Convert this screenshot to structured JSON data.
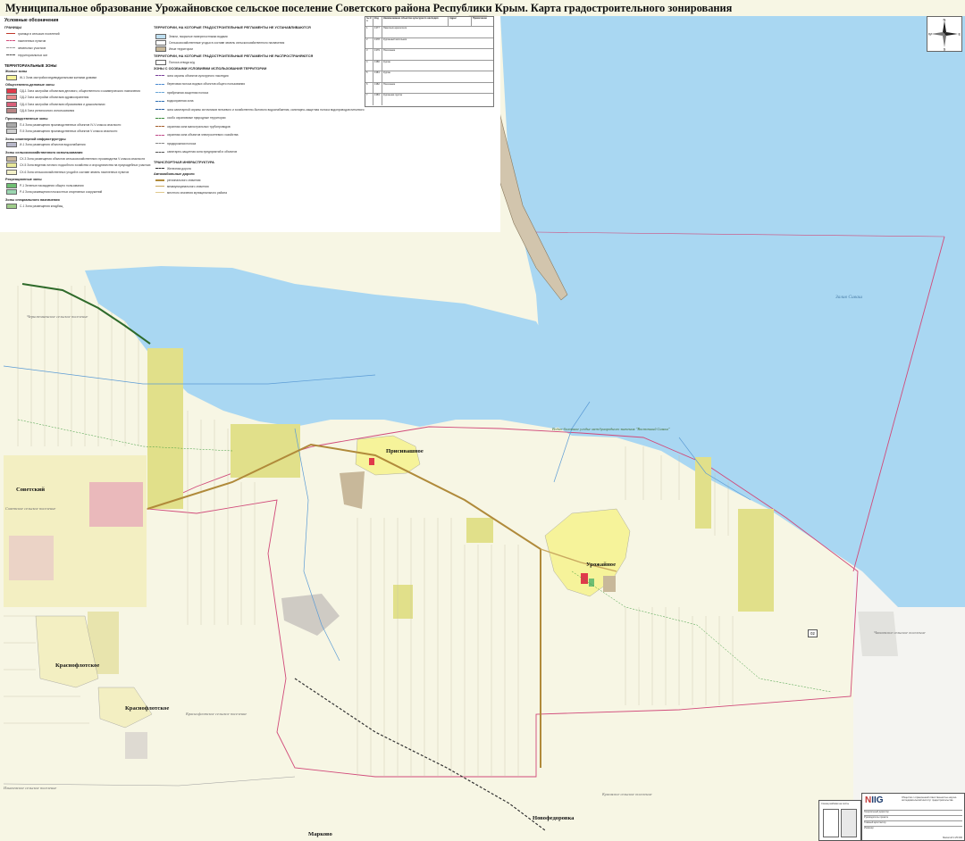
{
  "title": "Муниципальное образование Урожайновское сельское поселение Советского района Республики Крым. Карта градостроительного зонирования",
  "legend": {
    "heading": "Условные обозначения",
    "boundaries_heading": "ГРАНИЦЫ",
    "boundaries": [
      {
        "label": "граница в сельских поселений",
        "color": "#c0392b"
      },
      {
        "label": "населенных пунктов",
        "color": "#d14a7a"
      },
      {
        "label": "земельных участков",
        "color": "#999999"
      },
      {
        "label": "территориальных зон",
        "color": "#555555"
      }
    ],
    "zones_heading": "ТЕРРИТОРИАЛЬНЫЕ ЗОНЫ",
    "groups": [
      {
        "name": "Жилые зоны",
        "items": [
          {
            "code": "Ж-1",
            "label": "Ж-1 Зона застройки индивидуальными жилыми домами",
            "color": "#f6f39a"
          }
        ]
      },
      {
        "name": "Общественно-деловые зоны",
        "items": [
          {
            "code": "ОД-1",
            "label": "ОД-1 Зона застройки объектами делового, общественного и коммерческого назначения",
            "color": "#e03a4a"
          },
          {
            "code": "ОД-2",
            "label": "ОД-2 Зона застройки объектами здравоохранения",
            "color": "#e88a8a"
          },
          {
            "code": "ОД-4",
            "label": "ОД-4 Зона застройки объектами образования и дошкольными",
            "color": "#d9607a"
          },
          {
            "code": "ОД-6",
            "label": "ОД-6 Зона религиозного использования",
            "color": "#b98585"
          }
        ]
      },
      {
        "name": "Производственные зоны",
        "items": [
          {
            "code": "П-4",
            "label": "П-4 Зона размещения производственных объектов IV-V класса опасности",
            "color": "#a9a9a9"
          },
          {
            "code": "П-5",
            "label": "П-5 Зона размещения производственных объектов V класса опасности",
            "color": "#cfcfcf"
          }
        ]
      },
      {
        "name": "Зоны инженерной инфраструктуры",
        "items": [
          {
            "code": "И-1",
            "label": "И-1 Зона размещения объектов водоснабжения",
            "color": "#b7b7c9"
          }
        ]
      },
      {
        "name": "Зоны сельскохозяйственного использования",
        "items": [
          {
            "code": "СХ-3",
            "label": "СХ-3 Зона размещения объектов сельскохозяйственного производства V класса опасности",
            "color": "#c9b8a0"
          },
          {
            "code": "СХ-5",
            "label": "СХ-5 Зона ведения личного подсобного хозяйства и огородничества на приусадебных участках",
            "color": "#e7e79a"
          },
          {
            "code": "СХ-6",
            "label": "СХ-6 Зона сельскохозяйственных угодий в составе земель населенных пунктов",
            "color": "#f3f0c8"
          }
        ]
      },
      {
        "name": "Рекреационные зоны",
        "items": [
          {
            "code": "Р-1",
            "label": "Р-1 Зеленые насаждения общего пользования",
            "color": "#6fbf73"
          },
          {
            "code": "Р-4",
            "label": "Р-4 Зона размещения плоскостных спортивных сооружений",
            "color": "#9ad6b0"
          }
        ]
      },
      {
        "name": "Зоны специального назначения",
        "items": [
          {
            "code": "С-1",
            "label": "С-1 Зона размещения кладбищ",
            "color": "#9fcc8a"
          }
        ]
      }
    ],
    "not_established_heading": "ТЕРРИТОРИИ, НА КОТОРЫЕ ГРАДОСТРОИТЕЛЬНЫЕ РЕГЛАМЕНТЫ НЕ УСТАНАВЛИВАЮТСЯ",
    "not_established": [
      {
        "label": "Земли, покрытые поверхностными водами",
        "color": "#bfe0f2"
      },
      {
        "label": "Сельскохозяйственные угодья в составе земель сельскохозяйственного назначения",
        "color": "#ffffff"
      },
      {
        "label": "Иные территории",
        "color": "#c8b89a"
      }
    ],
    "not_applied_heading": "ТЕРРИТОРИИ, НА КОТОРЫЕ ГРАДОСТРОИТЕЛЬНЫЕ РЕГЛАМЕНТЫ НЕ РАСПРОСТРАНЯЮТСЯ",
    "not_applied": [
      {
        "label": "Полоса отвода ж/д",
        "color": "#ffffff"
      }
    ],
    "special_heading": "ЗОНЫ С ОСОБЫМИ УСЛОВИЯМИ ИСПОЛЬЗОВАНИЯ ТЕРРИТОРИИ",
    "special": [
      "зона охраны объектов культурного наследия",
      "береговая полоса водных объектов общего пользования",
      "прибрежная защитная полоса",
      "водоохранная зона",
      "зона санитарной охраны источников питьевого и хозяйственно-бытового водоснабжения, санитарно-защитная полоса водопроводов питьевого",
      "особо охраняемые природные территории",
      "охранная зона магистральных трубопроводов",
      "охранная зона объектов электросетевого хозяйства",
      "придорожная полоса",
      "санитарно-защитная зона предприятий и объектов"
    ],
    "transport_heading": "ТРАНСПОРТНАЯ ИНФРАСТРУКТУРА",
    "railway_label": "Железная дорога",
    "roads_heading": "Автомобильные дороги",
    "roads": [
      {
        "label": "регионального значения",
        "color": "#b08a3a"
      },
      {
        "label": "межмуниципального значения",
        "color": "#c9a860"
      },
      {
        "label": "местного значения муниципального района",
        "color": "#e0c98d"
      }
    ]
  },
  "table": {
    "header": [
      "№ п/п",
      "Код",
      "Наименование объектов культурного наследия",
      "Адрес",
      "Примечание"
    ],
    "rows": [
      [
        "1",
        "1377",
        "Памятник археологии"
      ],
      [
        "2",
        "1378",
        "Курганный могильник"
      ],
      [
        "3",
        "1379",
        "Поселение"
      ],
      [
        "4",
        "1380",
        "Курган"
      ],
      [
        "5",
        "1381",
        "Курган"
      ],
      [
        "6",
        "1382",
        "Поселение"
      ],
      [
        "7",
        "1383",
        "Курганная группа"
      ]
    ]
  },
  "compass": {
    "n": "N",
    "s": "S",
    "e": "E",
    "w": "W"
  },
  "places": {
    "privolnoe": "Присивашное",
    "urozhaynoe": "Урожайное",
    "sovetsky": "Советский",
    "krasnoflotskoe1": "Краснофлотское",
    "krasnoflotskoe2": "Краснофлотское",
    "novofedorovka": "Новофедоровка",
    "markovo": "Марково"
  },
  "boundary_labels": {
    "sovetskoe": "Советское сельское поселение",
    "chernozemnenskoe": "Черноземненское сельское поселение",
    "krasnoflotskoe": "Краснофлотское сельское поселение",
    "krasnogvardeyskoe": "Красногвардейское сельское поселение",
    "ilichevskoe": "Ильичевское сельское поселение",
    "chapaevskoe": "Чапаевское сельское поселение",
    "kumovo": "Кумовское сельское поселение"
  },
  "water": {
    "bay": "Залив Сиваш",
    "reserve": "Водно-болотное угодье международного значения \"Восточный Сиваш\""
  },
  "road_number": "02",
  "stamp": {
    "logo_n": "N",
    "logo_rest": "IIG",
    "org": "Общество с ограниченной ответственностью научно-исследовательский институт градостроительства",
    "rows": [
      "Генеральный директор",
      "Руководитель проекта",
      "Главный архитектор",
      "Инженер"
    ],
    "scale": "Масштаб 1:25 000",
    "scale_box": "Схема разбивки на листы"
  },
  "colors": {
    "sea": "#a9d7f2",
    "land": "#f7f6e4",
    "residential": "#f6f39a",
    "agri_zone": "#e7e79a",
    "boundary": "#c0392b",
    "road": "#b08a3a"
  }
}
